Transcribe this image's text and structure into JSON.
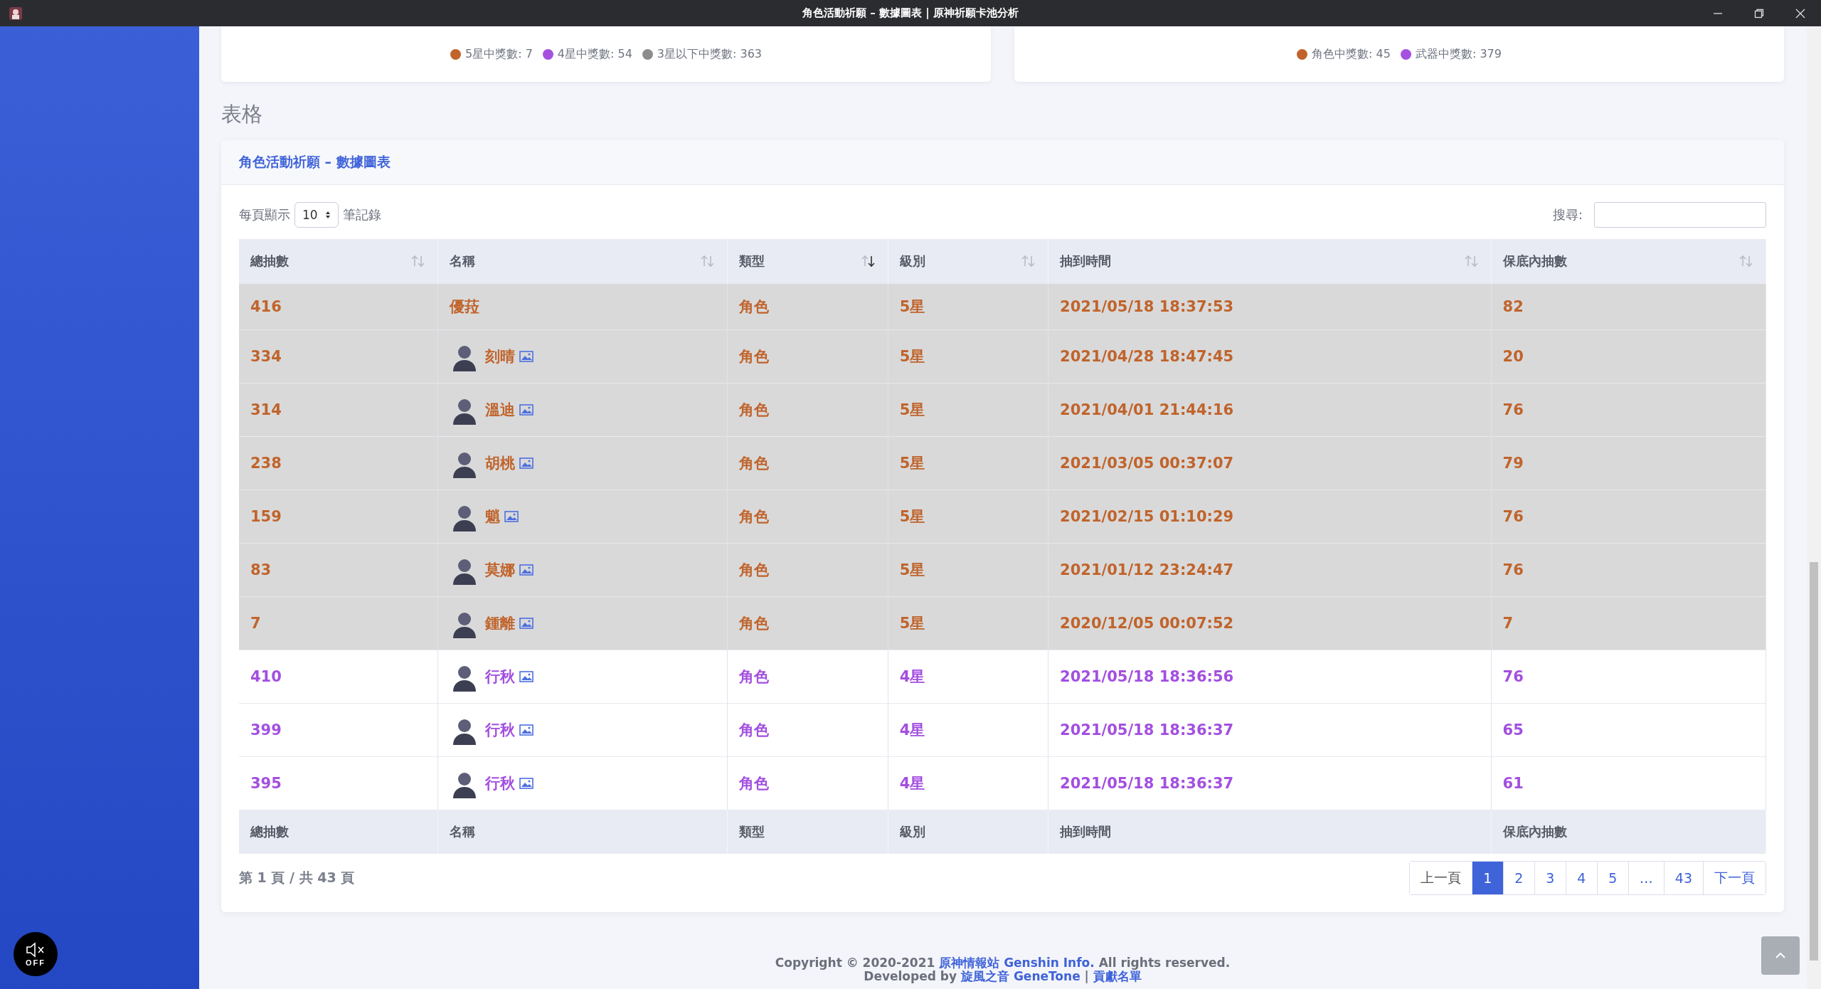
{
  "window": {
    "title": "角色活動祈願 – 數據圖表 | 原神祈願卡池分析"
  },
  "legend_cards": [
    {
      "items": [
        {
          "label": "5星中獎數: 7",
          "color": "#c0642c"
        },
        {
          "label": "4星中獎數: 54",
          "color": "#a551e0"
        },
        {
          "label": "3星以下中獎數: 363",
          "color": "#8c8c8c"
        }
      ]
    },
    {
      "items": [
        {
          "label": "角色中獎數: 45",
          "color": "#c0642c"
        },
        {
          "label": "武器中獎數: 379",
          "color": "#a551e0"
        }
      ]
    }
  ],
  "section_title": "表格",
  "table_card": {
    "title": "角色活動祈願 – 數據圖表",
    "length_prefix": "每頁顯示",
    "length_value": "10",
    "length_suffix": "筆記錄",
    "search_label": "搜尋:",
    "columns": [
      {
        "label": "總抽數",
        "sorted": false
      },
      {
        "label": "名稱",
        "sorted": false
      },
      {
        "label": "類型",
        "sorted": true
      },
      {
        "label": "級別",
        "sorted": false
      },
      {
        "label": "抽到時間",
        "sorted": false
      },
      {
        "label": "保底內抽數",
        "sorted": false
      }
    ],
    "rows": [
      {
        "kind": "five_star",
        "cells": [
          "416",
          "優菈",
          "角色",
          "5星",
          "2021/05/18 18:37:53",
          "82"
        ],
        "avatar": false
      },
      {
        "kind": "five_star",
        "cells": [
          "334",
          "刻晴",
          "角色",
          "5星",
          "2021/04/28 18:47:45",
          "20"
        ],
        "avatar": true
      },
      {
        "kind": "five_star",
        "cells": [
          "314",
          "溫迪",
          "角色",
          "5星",
          "2021/04/01 21:44:16",
          "76"
        ],
        "avatar": true
      },
      {
        "kind": "five_star",
        "cells": [
          "238",
          "胡桃",
          "角色",
          "5星",
          "2021/03/05 00:37:07",
          "79"
        ],
        "avatar": true
      },
      {
        "kind": "five_star",
        "cells": [
          "159",
          "魈",
          "角色",
          "5星",
          "2021/02/15 01:10:29",
          "76"
        ],
        "avatar": true
      },
      {
        "kind": "five_star",
        "cells": [
          "83",
          "莫娜",
          "角色",
          "5星",
          "2021/01/12 23:24:47",
          "76"
        ],
        "avatar": true
      },
      {
        "kind": "five_star",
        "cells": [
          "7",
          "鍾離",
          "角色",
          "5星",
          "2020/12/05 00:07:52",
          "7"
        ],
        "avatar": true
      },
      {
        "kind": "four_star",
        "cells": [
          "410",
          "行秋",
          "角色",
          "4星",
          "2021/05/18 18:36:56",
          "76"
        ],
        "avatar": true
      },
      {
        "kind": "four_star",
        "cells": [
          "399",
          "行秋",
          "角色",
          "4星",
          "2021/05/18 18:36:37",
          "65"
        ],
        "avatar": true
      },
      {
        "kind": "four_star",
        "cells": [
          "395",
          "行秋",
          "角色",
          "4星",
          "2021/05/18 18:36:37",
          "61"
        ],
        "avatar": true
      }
    ],
    "footer": [
      "總抽數",
      "名稱",
      "類型",
      "級別",
      "抽到時間",
      "保底內抽數"
    ],
    "info": "第 1 頁 / 共 43 頁",
    "pagination": {
      "previous": "上一頁",
      "next": "下一頁",
      "pages": [
        {
          "label": "1",
          "selected": true
        },
        {
          "label": "2",
          "selected": false
        },
        {
          "label": "3",
          "selected": false
        },
        {
          "label": "4",
          "selected": false
        },
        {
          "label": "5",
          "selected": false
        },
        {
          "label": "…",
          "selected": false
        },
        {
          "label": "43",
          "selected": false
        }
      ]
    }
  },
  "footer": {
    "copyright": "Copyright © 2020-2021 ",
    "site_link": "原神情報站 Genshin Info.",
    "rights": " All rights reserved.",
    "developed": "Developed by ",
    "dev_link": "旋風之音 GeneTone",
    "sep": " | ",
    "credits_link": "貢獻名單"
  },
  "sound_toggle": {
    "label": "OFF"
  }
}
